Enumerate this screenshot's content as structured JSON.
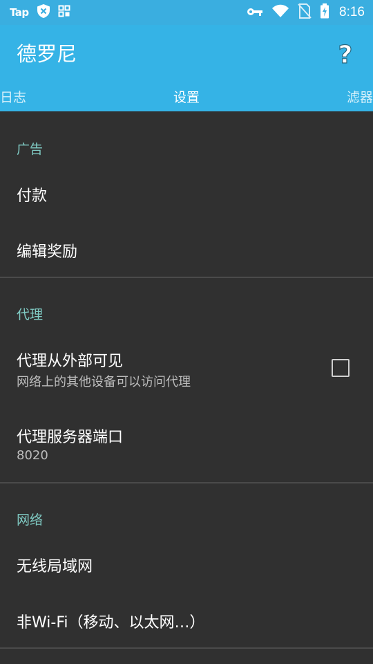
{
  "status_bar": {
    "app_label": "Tap",
    "time": "8:16",
    "icons": [
      "shield-icon",
      "grid-icon",
      "key-icon",
      "wifi-icon",
      "no-sim-icon",
      "battery-charging-icon"
    ]
  },
  "app_bar": {
    "title": "德罗尼",
    "help_icon": "help-icon",
    "help_glyph": "?"
  },
  "tabs": {
    "left": "日志",
    "center": "设置",
    "right": "滤器"
  },
  "sections": {
    "ads": {
      "header": "广告",
      "items": [
        {
          "title": "付款"
        },
        {
          "title": "编辑奖励"
        }
      ]
    },
    "proxy": {
      "header": "代理",
      "items": [
        {
          "title": "代理从外部可见",
          "summary": "网络上的其他设备可以访问代理",
          "checked": false
        },
        {
          "title": "代理服务器端口",
          "summary": "8020"
        }
      ]
    },
    "network": {
      "header": "网络",
      "items": [
        {
          "title": "无线局域网"
        },
        {
          "title": "非Wi-Fi（移动、以太网…）"
        }
      ]
    }
  },
  "colors": {
    "accent": "#35b3e6",
    "background": "#303030",
    "section_header": "#80cbc4"
  }
}
